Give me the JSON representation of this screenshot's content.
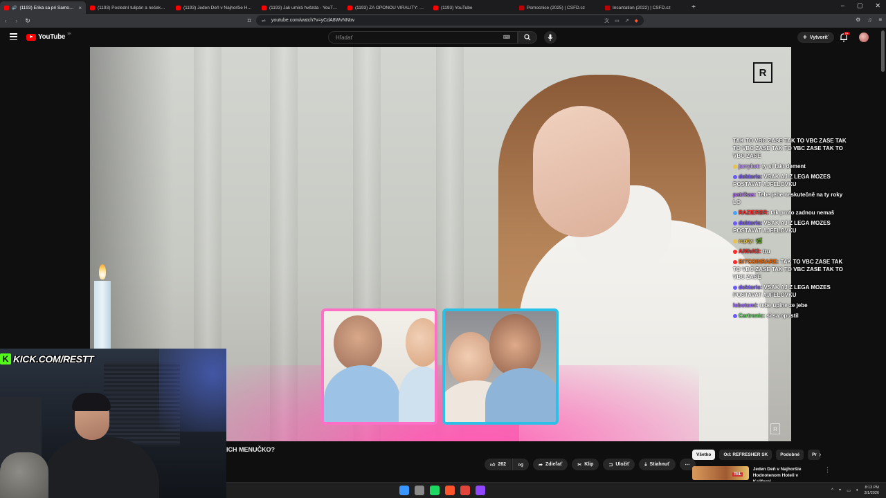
{
  "browser": {
    "tabs": [
      {
        "title": "(1193) Erika sa pri Samovi ne",
        "icon": "speaker-icon",
        "active": true,
        "favicon": "youtube"
      },
      {
        "title": "(1193) Poslední tulipán a nečekaný n",
        "active": false,
        "favicon": "youtube"
      },
      {
        "title": "(1193) Jeden Deň v Najhoršie Hodn",
        "active": false,
        "favicon": "youtube"
      },
      {
        "title": "(1193) Jak umírá hvězda - YouTube",
        "active": false,
        "favicon": "youtube"
      },
      {
        "title": "(1193) ZA OPONOU VIRALITY: MELI",
        "active": false,
        "favicon": "youtube"
      },
      {
        "title": "(1193) YouTube",
        "active": false,
        "favicon": "youtube"
      },
      {
        "title": "Pomocnice (2025) | ČSFD.cz",
        "active": false,
        "favicon": "csfd"
      },
      {
        "title": "Incantation (2022) | ČSFD.cz",
        "active": false,
        "favicon": "csfd"
      }
    ],
    "url": "youtube.com/watch?v=yCdA8WvNNtw"
  },
  "youtube": {
    "logo_text": "YouTube",
    "region": "SK",
    "search_placeholder": "Hľadať",
    "create_label": "Vytvoriť",
    "notif_badge": "9+"
  },
  "video": {
    "title_fragment": "ICH MENUČKO?",
    "kick_url": "KICK.COM/RESTT",
    "kick_logo": "K"
  },
  "chat": [
    {
      "user": "",
      "text": "TAK TO VBC ZASE TAK TO VBC ZASE TAK TO VBC ZASE TAK TO VBC ZASE TAK TO VBC ZASE",
      "color": "#ff6b00",
      "dot": ""
    },
    {
      "user": "jerryket:",
      "text": "ty si fakt dement",
      "color": "#c8a0ff",
      "dot": "#e8c24a"
    },
    {
      "user": "doktoris:",
      "text": "VSAK AJ Z LEGA MOZES POSTAVAT AJFELOVKU",
      "color": "#7d5cff",
      "dot": "#6b5bff"
    },
    {
      "user": "patrikas:",
      "text": "Tebe jebe neskutečně na ty roky LO",
      "color": "#b76cff",
      "dot": ""
    },
    {
      "user": "RAZIERBR:",
      "text": "tak proto zadnou nemaš",
      "color": "#ff2a2a",
      "dot": "#4aa3ff"
    },
    {
      "user": "doktoris:",
      "text": "VSAK AJ Z LEGA MOZES POSTAVAT AJFELOVKU",
      "color": "#7d5cff",
      "dot": "#6b5bff"
    },
    {
      "user": "rapty:",
      "text": "🌿",
      "color": "#e8c24a",
      "dot": "#e8c24a"
    },
    {
      "user": "AiWeN3:",
      "text": "tru",
      "color": "#ff2a2a",
      "dot": "#ff2a2a"
    },
    {
      "user": "BITCOINRARE:",
      "text": "TAK TO VBC ZASE TAK TO VBC ZASE TAK TO VBC ZASE TAK TO VBC ZASE",
      "color": "#ff6b00",
      "dot": "#ff2a2a"
    },
    {
      "user": "doktoris:",
      "text": "VSAK AJ Z LEGA MOZES POSTAVAT AJFELOVKU",
      "color": "#7d5cff",
      "dot": "#6b5bff"
    },
    {
      "user": "lobotomi:",
      "text": "tebe upine ze jebe",
      "color": "#a06bff",
      "dot": ""
    },
    {
      "user": "Cartronic:",
      "text": "si sa opustil",
      "color": "#5ad55a",
      "dot": "#6b5bff"
    }
  ],
  "actions": {
    "likes": "262",
    "share": "Zdieľať",
    "clip": "Klip",
    "save": "Uložiť",
    "download": "Stiahnuť"
  },
  "chips": [
    "Všetko",
    "Od: REFRESHER SK",
    "Podobné",
    "Pr"
  ],
  "reco": {
    "title": "Jeden Deň v Najhoršie Hodnotenom Hoteli v Kaliforni...",
    "thumb_badge": "TEL"
  },
  "taskbar": {
    "time": "8:13 PM",
    "date": "3/1/2026",
    "icon_colors": [
      "#3a96ff",
      "#8a8a8a",
      "#1ed760",
      "#fb542b",
      "#e0443a",
      "#9146ff"
    ]
  }
}
